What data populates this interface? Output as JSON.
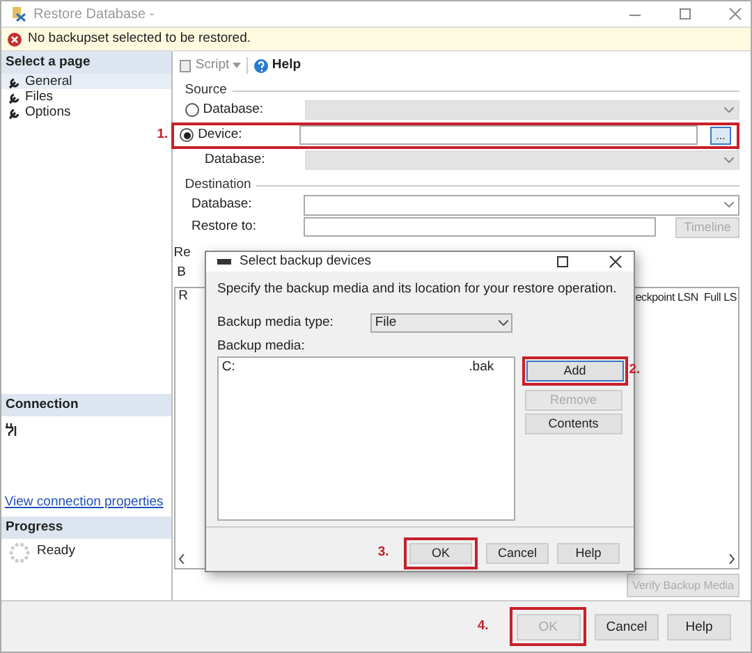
{
  "window": {
    "title": "Restore Database -"
  },
  "warning": {
    "text": "No backupset selected to be restored."
  },
  "sidebar": {
    "pages_header": "Select a page",
    "pages": [
      {
        "label": "General",
        "selected": true
      },
      {
        "label": "Files",
        "selected": false
      },
      {
        "label": "Options",
        "selected": false
      }
    ],
    "connection_header": "Connection",
    "connection_link": "View connection properties",
    "progress_header": "Progress",
    "progress_status": "Ready"
  },
  "toolbar": [
    {
      "kind": "script",
      "label": "Script"
    },
    {
      "kind": "help",
      "label": "Help"
    }
  ],
  "source": {
    "title": "Source",
    "step": "1.",
    "options": [
      {
        "label": "Database:",
        "selected": false
      },
      {
        "label": "Device:",
        "selected": true
      }
    ],
    "database_label": "Database:",
    "browse_button": "..."
  },
  "destination": {
    "title": "Destination",
    "database_label": "Database:",
    "restore_to_label": "Restore to:",
    "timeline_button": {
      "label": "Timeline",
      "disabled": true
    }
  },
  "restore_plan": {
    "section_fragment": "Re",
    "tab_fragment": "B",
    "columns": [
      "R",
      "eckpoint LSN",
      "Full LS"
    ],
    "verify_button": {
      "label": "Verify Backup Media",
      "disabled": true
    }
  },
  "dialog": {
    "title": "Select backup devices",
    "instruction": "Specify the backup media and its location for your restore operation.",
    "media_type_label": "Backup media type:",
    "media_type": "File",
    "media_label": "Backup media:",
    "media": [
      {
        "path_start": "C:",
        "path_end": ".bak"
      }
    ],
    "buttons": [
      {
        "label": "Add",
        "disabled": false,
        "step": "2."
      },
      {
        "label": "Remove",
        "disabled": true
      },
      {
        "label": "Contents",
        "disabled": false
      }
    ],
    "footer_buttons": [
      {
        "label": "OK",
        "step": "3."
      },
      {
        "label": "Cancel"
      },
      {
        "label": "Help"
      }
    ]
  },
  "footer_buttons": [
    {
      "label": "OK",
      "disabled": true,
      "step": "4."
    },
    {
      "label": "Cancel",
      "disabled": false
    },
    {
      "label": "Help",
      "disabled": false
    }
  ]
}
